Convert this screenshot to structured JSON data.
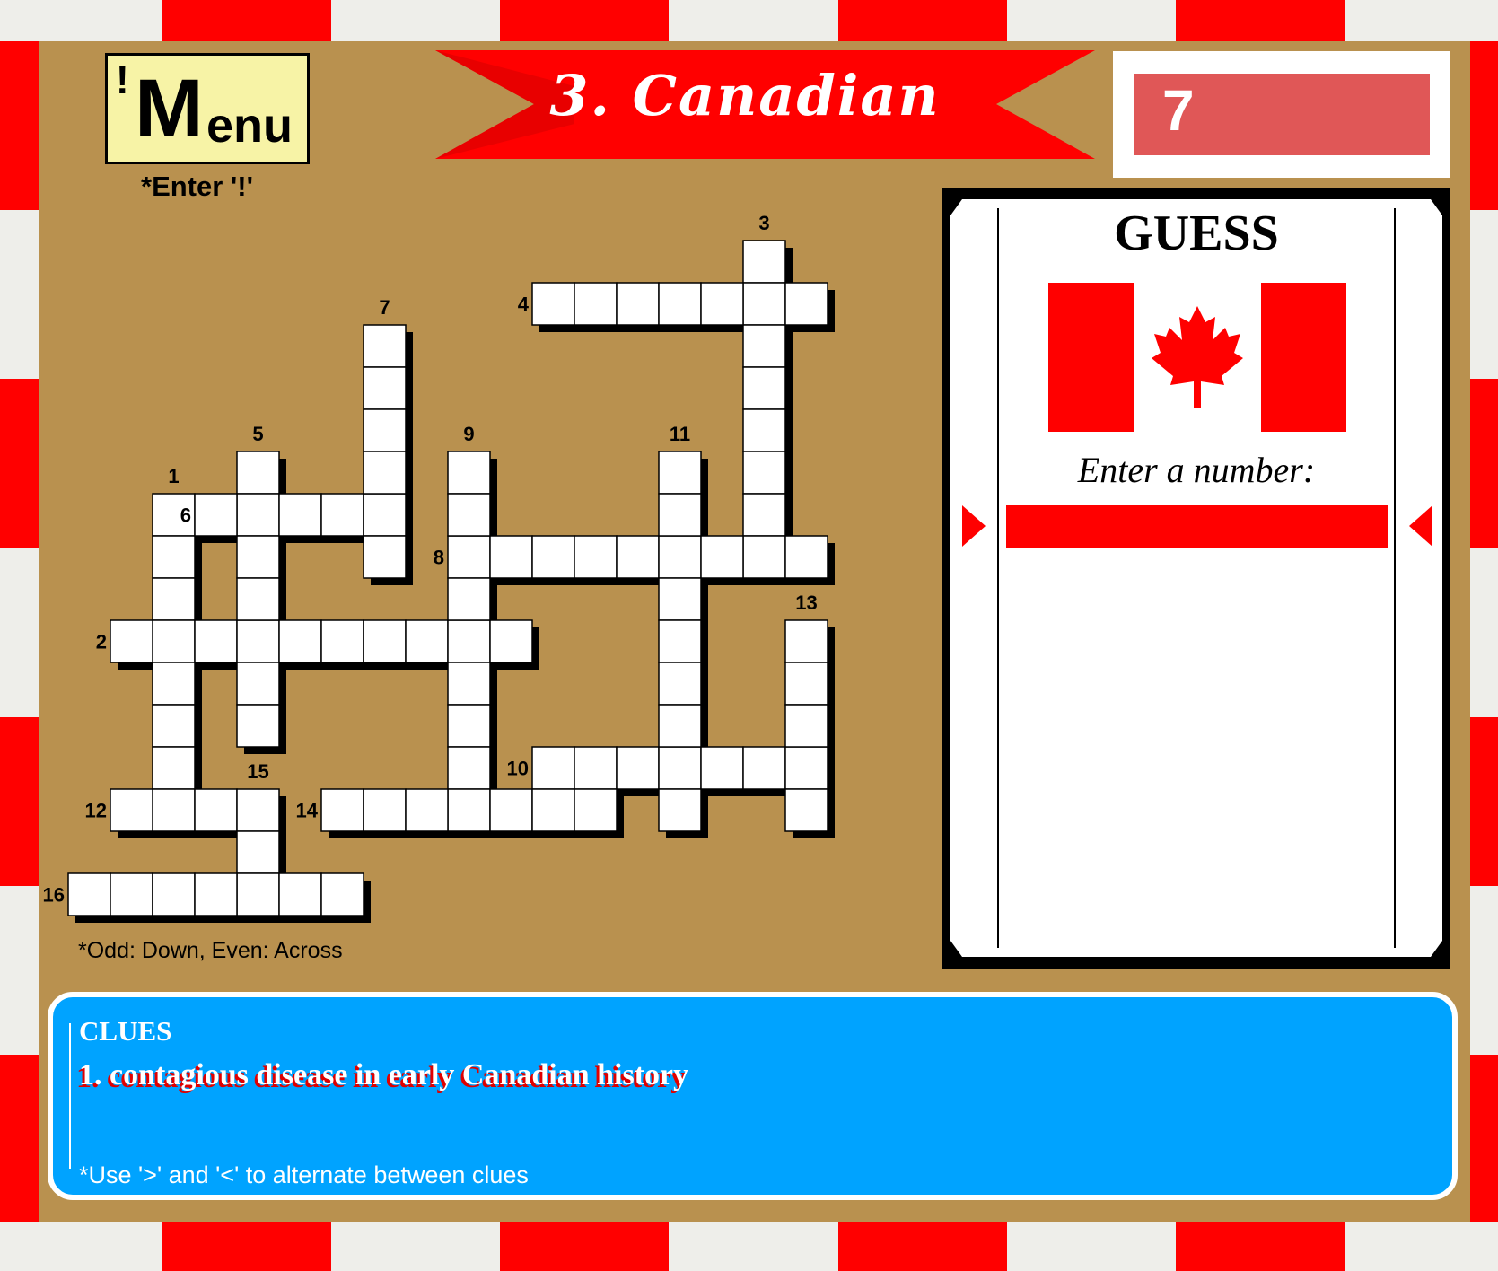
{
  "menu": {
    "exclaim": "!",
    "big_letter": "M",
    "rest": "enu",
    "hint": "*Enter '!'"
  },
  "title": "3. Canadian",
  "score": "7",
  "grid_hint": "*Odd: Down, Even: Across",
  "guess": {
    "title": "GUESS",
    "prompt": "Enter a number:",
    "input_value": ""
  },
  "clues": {
    "heading": "CLUES",
    "current": "1. contagious disease in early Canadian history",
    "hint": "*Use '>' and '<' to alternate between clues"
  },
  "colors": {
    "red": "#ff0000",
    "tan": "#b9914f",
    "blue": "#00a3ff",
    "score_bg": "#e05757",
    "menu_bg": "#f7f3a6"
  },
  "icons": {
    "flag": "maple-leaf-flag-icon",
    "arrows": [
      "triangle-right-icon",
      "triangle-left-icon"
    ]
  },
  "crossword": {
    "words": [
      {
        "number": "1",
        "dir": "down",
        "length": 8
      },
      {
        "number": "2",
        "dir": "across",
        "length": 10
      },
      {
        "number": "3",
        "dir": "down",
        "length": 8
      },
      {
        "number": "4",
        "dir": "across",
        "length": 7
      },
      {
        "number": "5",
        "dir": "down",
        "length": 7
      },
      {
        "number": "6",
        "dir": "across",
        "length": 5
      },
      {
        "number": "7",
        "dir": "down",
        "length": 6
      },
      {
        "number": "8",
        "dir": "across",
        "length": 9
      },
      {
        "number": "9",
        "dir": "down",
        "length": 9
      },
      {
        "number": "10",
        "dir": "across",
        "length": 7
      },
      {
        "number": "11",
        "dir": "down",
        "length": 9
      },
      {
        "number": "12",
        "dir": "across",
        "length": 4
      },
      {
        "number": "13",
        "dir": "down",
        "length": 5
      },
      {
        "number": "14",
        "dir": "across",
        "length": 7
      },
      {
        "number": "15",
        "dir": "down",
        "length": 3
      },
      {
        "number": "16",
        "dir": "across",
        "length": 7
      }
    ]
  }
}
